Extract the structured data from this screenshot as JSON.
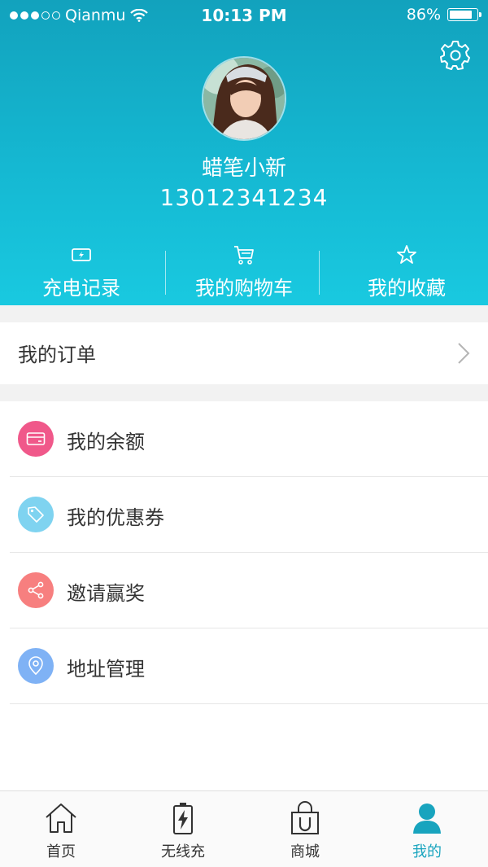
{
  "status_bar": {
    "carrier": "Qianmu",
    "time": "10:13 PM",
    "battery_text": "86%",
    "battery_level": 0.86,
    "signal_bars_filled": 3,
    "signal_bars_total": 5
  },
  "profile": {
    "username": "蜡笔小新",
    "phone": "13012341234"
  },
  "quick_actions": [
    {
      "label": "充电记录",
      "icon": "charge-record-icon"
    },
    {
      "label": "我的购物车",
      "icon": "shopping-cart-icon"
    },
    {
      "label": "我的收藏",
      "icon": "star-icon"
    }
  ],
  "orders": {
    "label": "我的订单"
  },
  "menu": [
    {
      "label": "我的余额",
      "icon": "wallet-icon",
      "color": "#f0588a"
    },
    {
      "label": "我的优惠券",
      "icon": "coupon-tag-icon",
      "color": "#7fd3f0"
    },
    {
      "label": "邀请赢奖",
      "icon": "share-icon",
      "color": "#f77f7f"
    },
    {
      "label": "地址管理",
      "icon": "location-pin-icon",
      "color": "#7fb2f5"
    }
  ],
  "tabs": [
    {
      "label": "首页",
      "icon": "home-icon"
    },
    {
      "label": "无线充",
      "icon": "battery-charge-icon"
    },
    {
      "label": "商城",
      "icon": "shopping-bag-icon"
    },
    {
      "label": "我的",
      "icon": "user-icon",
      "active": true
    }
  ],
  "colors": {
    "accent": "#18a4be",
    "header_top": "#12a2bd",
    "header_bottom": "#19c9e0"
  }
}
